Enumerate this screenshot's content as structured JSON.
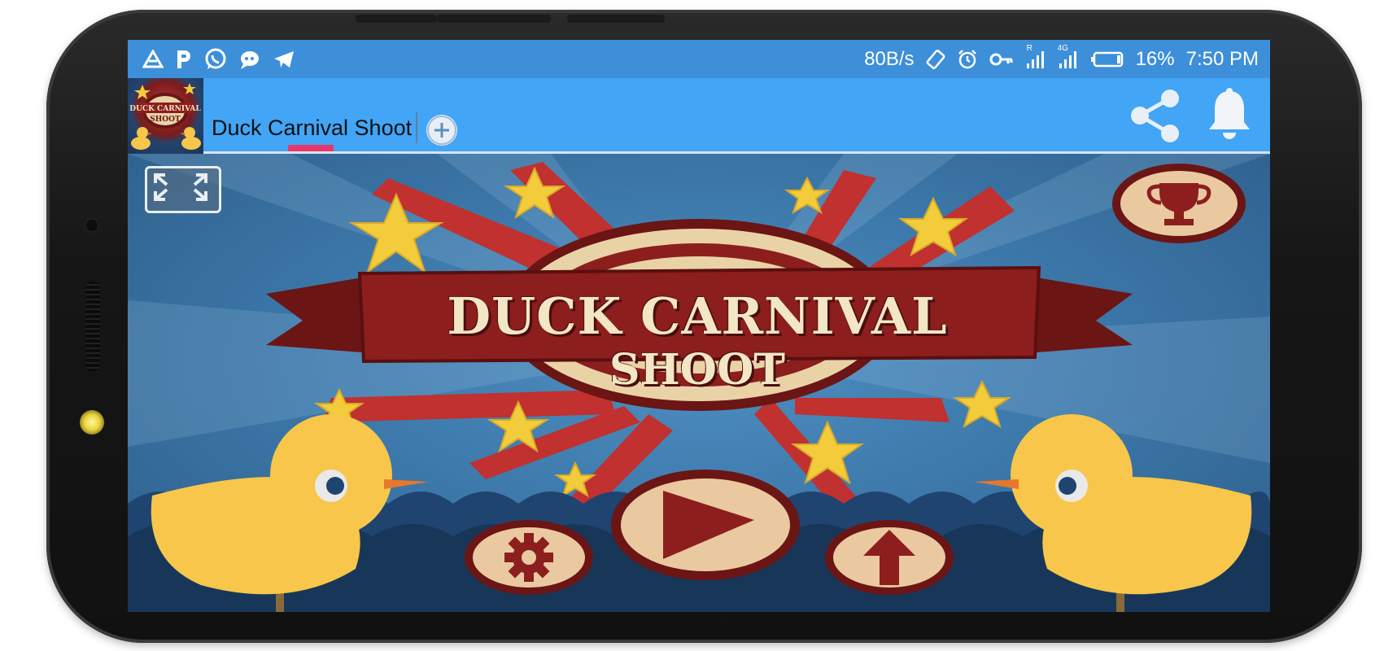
{
  "status_bar": {
    "left_icons": [
      "drive-icon",
      "p-app-icon",
      "whatsapp-icon",
      "chat-bubble-icon",
      "telegram-icon"
    ],
    "speed": "80B/s",
    "battery": "16%",
    "time": "7:50 PM",
    "right_icons": [
      "rotate-icon",
      "alarm-icon",
      "vpn-key-icon",
      "signal-r-icon",
      "signal-4g-icon",
      "battery-icon"
    ],
    "network_labels": {
      "roaming": "R",
      "lte": "4G"
    },
    "bg_color": "#3d8fda"
  },
  "app_bar": {
    "title": "Duck Carnival Shoot",
    "thumb_text_1": "DUCK CARNIVAL",
    "thumb_text_2": "SHOOT",
    "bg_color": "#42a5f5",
    "tab_indicator_color": "#e8376d",
    "actions": [
      "add-tab-icon",
      "share-icon",
      "bell-icon"
    ]
  },
  "game": {
    "title_line1": "DUCK CARNIVAL",
    "title_line2": "SHOOT",
    "buttons": [
      "fullscreen-icon",
      "trophy-icon",
      "settings-icon",
      "play-icon",
      "upload-icon"
    ],
    "colors": {
      "banner": "#7b1c1c",
      "cream": "#f3e6c4",
      "star": "#f2cc3a",
      "duck": "#f7c64a",
      "sky": "#3d79ab"
    }
  }
}
